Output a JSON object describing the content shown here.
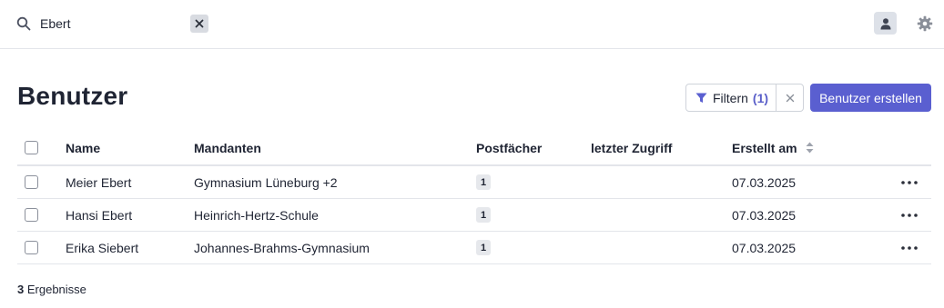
{
  "search": {
    "value": "Ebert",
    "icon": "search-icon"
  },
  "page": {
    "title": "Benutzer"
  },
  "toolbar": {
    "filter_label": "Filtern",
    "filter_count": "(1)",
    "create_label": "Benutzer erstellen"
  },
  "table": {
    "columns": {
      "name": "Name",
      "mandanten": "Mandanten",
      "postfaecher": "Postfächer",
      "letzter_zugriff": "letzter Zugriff",
      "erstellt_am": "Erstellt am"
    },
    "rows": [
      {
        "name": "Meier Ebert",
        "mandanten": "Gymnasium Lüneburg +2",
        "postfaecher": "1",
        "letzter_zugriff": "",
        "erstellt_am": "07.03.2025"
      },
      {
        "name": "Hansi Ebert",
        "mandanten": "Heinrich-Hertz-Schule",
        "postfaecher": "1",
        "letzter_zugriff": "",
        "erstellt_am": "07.03.2025"
      },
      {
        "name": "Erika Siebert",
        "mandanten": "Johannes-Brahms-Gymnasium",
        "postfaecher": "1",
        "letzter_zugriff": "",
        "erstellt_am": "07.03.2025"
      }
    ]
  },
  "footer": {
    "count": "3",
    "count_label": "Ergebnisse"
  },
  "colors": {
    "accent": "#5a5fd0",
    "border": "#e3e5ea",
    "text": "#1f2433"
  }
}
